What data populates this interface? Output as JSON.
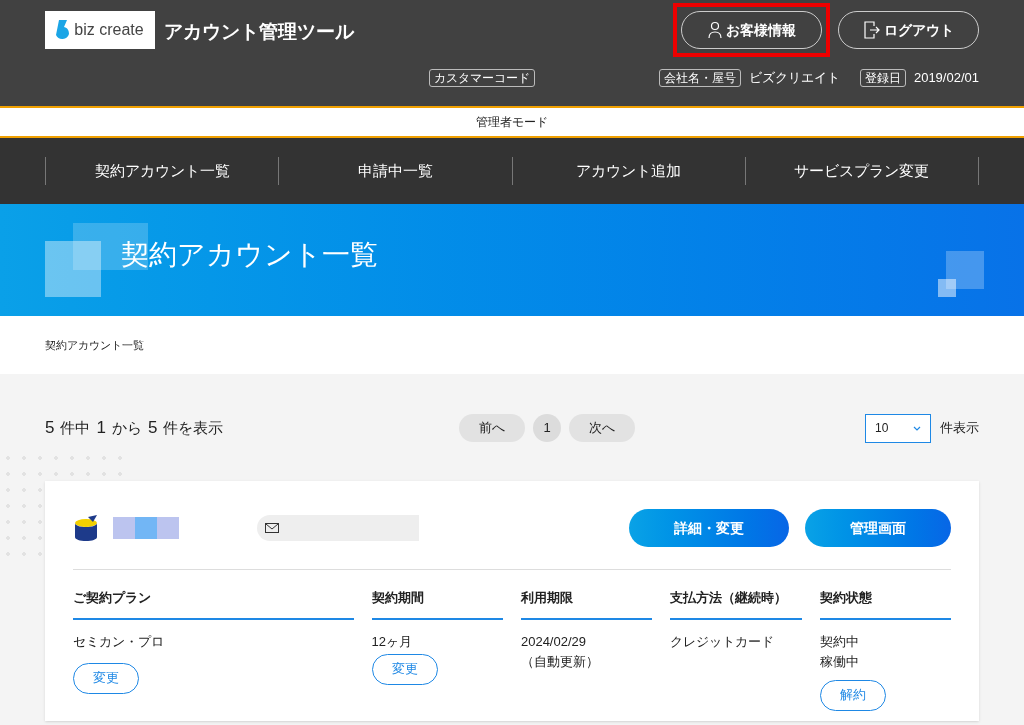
{
  "header": {
    "logo": "biz create",
    "title": "アカウント管理ツール",
    "buttons": [
      {
        "kind": "user",
        "label": "お客様情報",
        "highlighted": true
      },
      {
        "kind": "logout",
        "label": "ログアウト",
        "highlighted": false
      }
    ],
    "info": [
      {
        "tag": "カスタマーコード"
      },
      {
        "tag": "会社名・屋号",
        "value": "ビズクリエイト"
      },
      {
        "tag": "登録日",
        "value": "2019/02/01"
      }
    ]
  },
  "mode_bar": "管理者モード",
  "nav": [
    "契約アカウント一覧",
    "申請中一覧",
    "アカウント追加",
    "サービスプラン変更"
  ],
  "banner": {
    "title": "契約アカウント一覧"
  },
  "breadcrumb": "契約アカウント一覧",
  "listing": {
    "summary": [
      {
        "kind": "num",
        "text": "5"
      },
      {
        "kind": "word",
        "text": "件中"
      },
      {
        "kind": "num",
        "text": "1"
      },
      {
        "kind": "word",
        "text": "から"
      },
      {
        "kind": "num",
        "text": "5"
      },
      {
        "kind": "word",
        "text": "件を表示"
      }
    ],
    "pager": [
      {
        "label": "前へ",
        "selected": false
      },
      {
        "label": "1",
        "selected": true
      },
      {
        "label": "次へ",
        "selected": false
      }
    ],
    "per_page": {
      "value": "10",
      "label": "件表示"
    }
  },
  "card": {
    "buttons": [
      "詳細・変更",
      "管理画面"
    ],
    "columns": [
      {
        "heading": "ご契約プラン",
        "lines": [
          "セミカン・プロ"
        ],
        "action": "変更",
        "wide": true
      },
      {
        "heading": "契約期間",
        "lines": [
          "12ヶ月"
        ],
        "action": "変更",
        "wide": false
      },
      {
        "heading": "利用期限",
        "lines": [
          "2024/02/29",
          "（自動更新）"
        ],
        "wide": false
      },
      {
        "heading": "支払方法（継続時）",
        "lines": [
          "クレジットカード"
        ],
        "wide": false
      },
      {
        "heading": "契約状態",
        "lines": [
          "契約中",
          "稼働中"
        ],
        "action": "解約",
        "wide": false
      }
    ]
  }
}
